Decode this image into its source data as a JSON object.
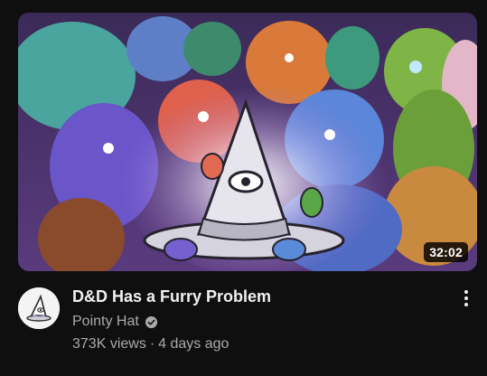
{
  "video": {
    "title": "D&D Has a Furry Problem",
    "duration": "32:02",
    "views": "373K views",
    "separator": "·",
    "age": "4 days ago",
    "thumbnail_icon": "pointy-hat-wizard-with-furry-characters-illustration"
  },
  "channel": {
    "name": "Pointy Hat",
    "verified": true,
    "avatar_icon": "pointy-hat-logo-icon"
  },
  "actions": {
    "menu_icon": "more-vert-icon"
  },
  "colors": {
    "background": "#0f0f0f",
    "title_text": "#f1f1f1",
    "secondary_text": "#aaaaaa"
  }
}
